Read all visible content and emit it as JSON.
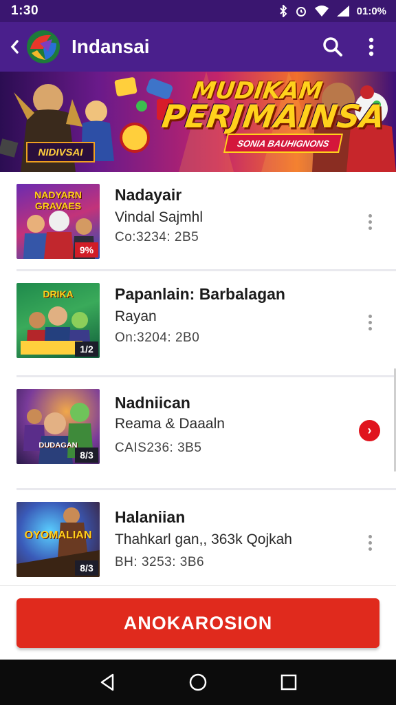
{
  "status_bar": {
    "time": "1:30",
    "battery_text": "01:0%"
  },
  "app_bar": {
    "title": "Indansai"
  },
  "banner": {
    "title_line1": "MUDIKAM",
    "title_line2": "PERJMAINSA",
    "ribbon_text": "SONIA BAUHIGNONS",
    "badge_text": "NIDIVSAI"
  },
  "items": [
    {
      "title": "Nadayair",
      "subtitle": "Vindal Sajmhl",
      "meta": "Co:3234: 2B5",
      "thumb_caption": "NADYARN GRAVAES",
      "thumb_tag": "9%",
      "action": "more"
    },
    {
      "title": "Papanlain: Barbalagan",
      "subtitle": "Rayan",
      "meta": "On:3204: 2B0",
      "thumb_caption": "DRIKA",
      "thumb_tag": "1/2",
      "action": "more"
    },
    {
      "title": "Nadniican",
      "subtitle": "Reama & Daaaln",
      "meta": "CAIS236: 3B5",
      "thumb_caption": "DUDAGAN",
      "thumb_tag": "8/3",
      "action": "arrow"
    },
    {
      "title": "Halaniian",
      "subtitle": "Thahkarl gan,, 363k Qojkah",
      "meta": "BH: 3253: 3B6",
      "thumb_caption": "OYOMALIAN",
      "thumb_tag": "8/3",
      "action": "more"
    }
  ],
  "primary_button": {
    "label": "ANOKAROSION"
  },
  "colors": {
    "status_bar": "#3a1670",
    "app_bar": "#4a1f8c",
    "accent": "#e02a1d",
    "nav_bar": "#0c0c0c"
  }
}
